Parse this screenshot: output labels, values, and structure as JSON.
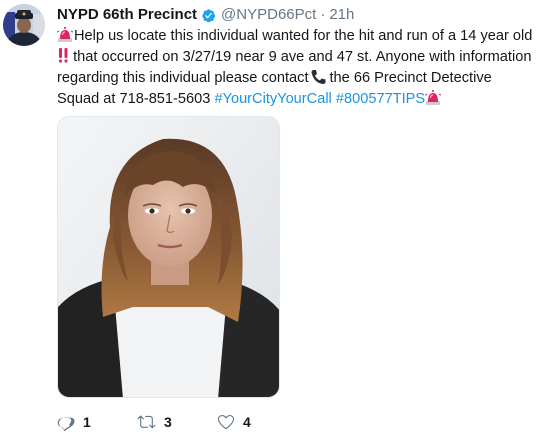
{
  "tweet": {
    "author_name": "NYPD 66th Precinct",
    "handle": "@NYPD66Pct",
    "separator": "·",
    "time": "21h",
    "text_part1": "Help us locate this individual wanted for the hit and run of a 14 year old",
    "text_part2": "that occurred on 3/27/19 near 9 ave and 47 st. Anyone with information regarding this individual please contact",
    "text_part3": "the 66 Precinct Detective Squad at 718-851-5603",
    "hashtags": [
      "#YourCityYourCall",
      "#800577TIPS"
    ],
    "emojis": [
      "police-car-light",
      "double-exclamation",
      "telephone",
      "police-car-light"
    ]
  },
  "actions": {
    "replies": "1",
    "retweets": "3",
    "likes": "4"
  },
  "colors": {
    "link": "#1b95e0",
    "muted": "#657786",
    "text": "#14171a",
    "verified": "#1da1f2"
  }
}
